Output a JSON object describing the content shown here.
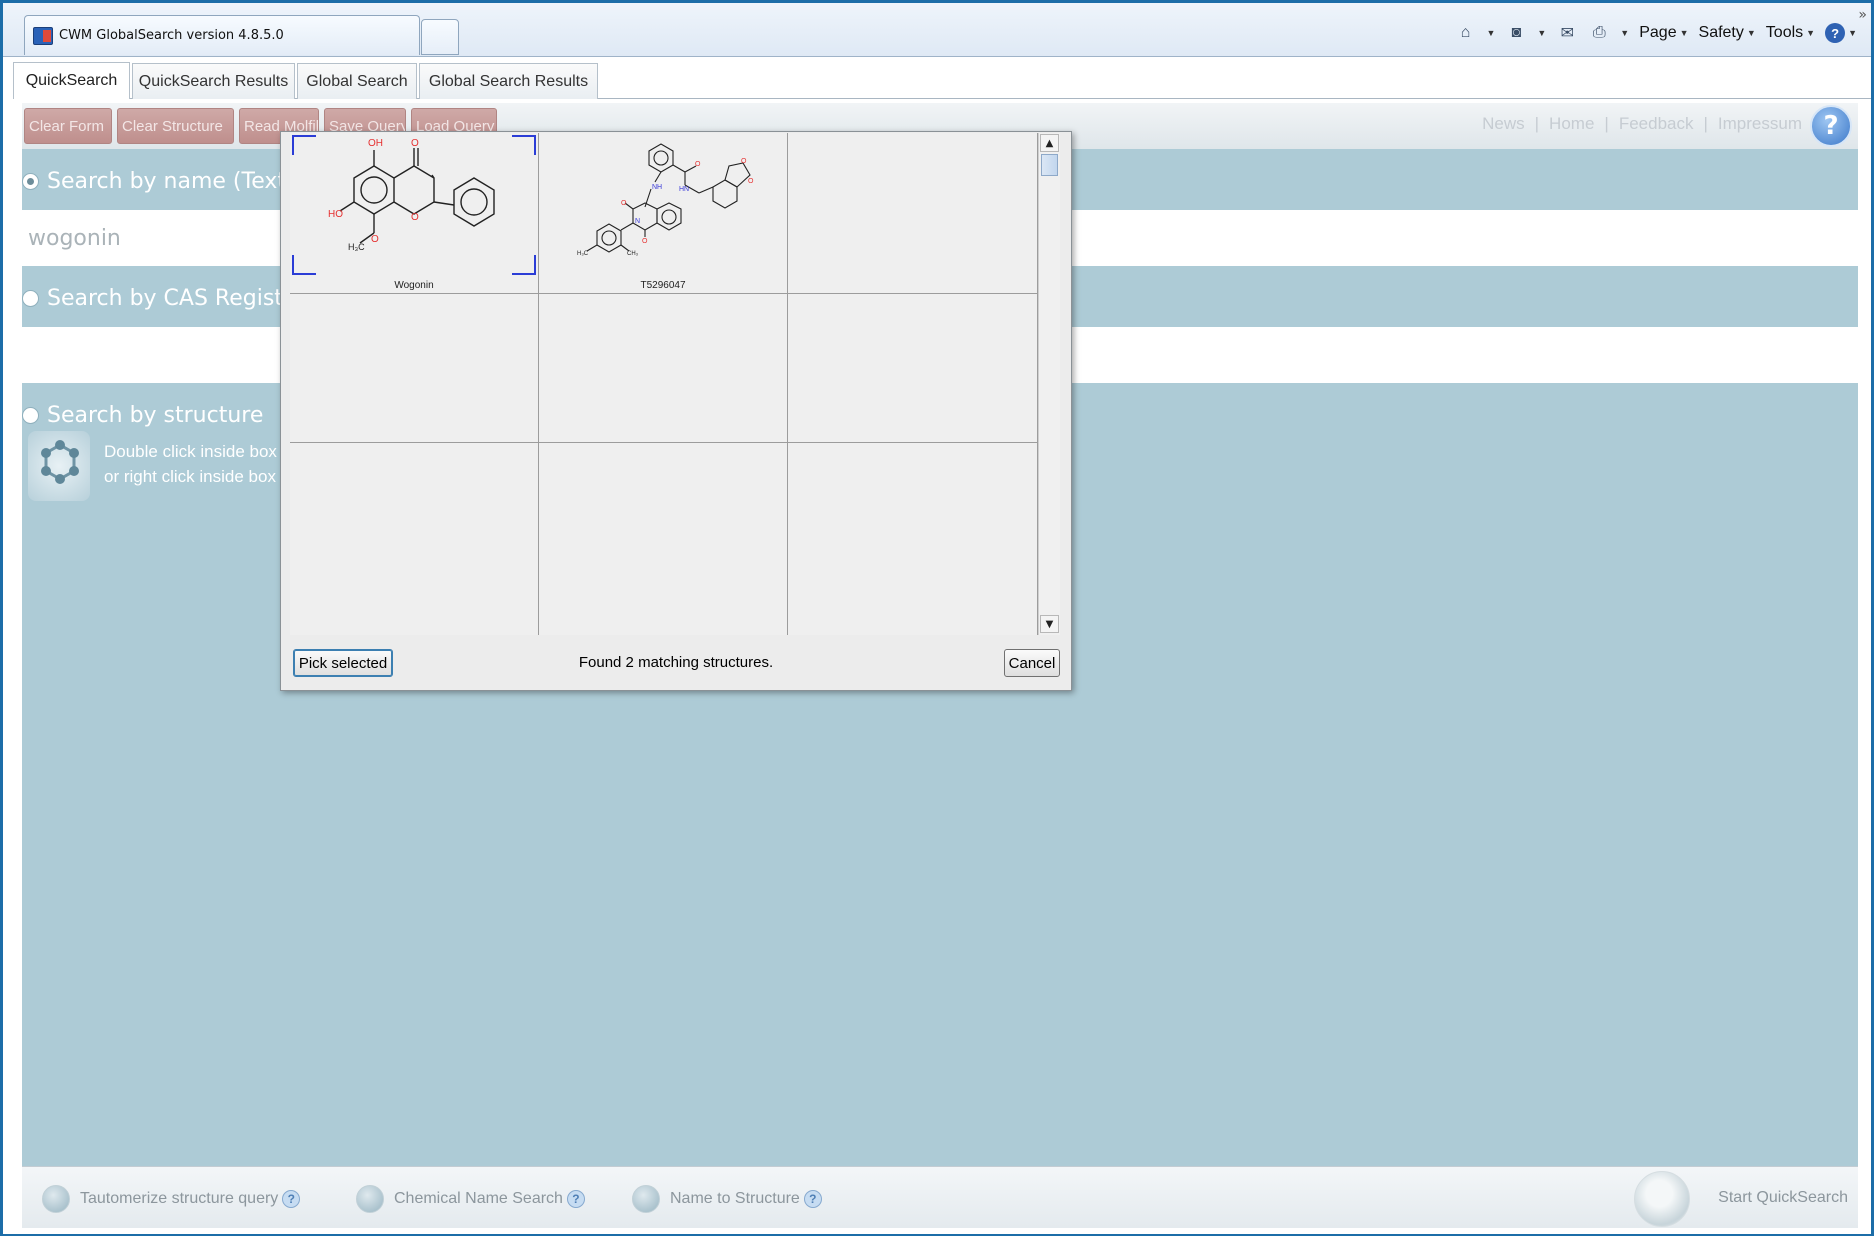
{
  "browser": {
    "tab_title": "CWM GlobalSearch version 4.8.5.0",
    "menus": [
      "Page",
      "Safety",
      "Tools"
    ],
    "overflow": "»"
  },
  "app_tabs": [
    "QuickSearch",
    "QuickSearch Results",
    "Global Search",
    "Global Search Results"
  ],
  "toolbar": {
    "buttons": [
      "Clear Form",
      "Clear Structure",
      "Read Molfile",
      "Save Query",
      "Load Query"
    ],
    "links": [
      "News",
      "Home",
      "Feedback",
      "Impressum"
    ],
    "sep": "|",
    "help": "?"
  },
  "search": {
    "by_name_label": "Search by name (Text)",
    "name_value": "wogonin",
    "by_cas_label": "Search by CAS Registry Number",
    "cas_value": "",
    "by_structure_label": "Search by structure",
    "structure_hint_1": "Double click inside box to draw structure",
    "structure_hint_2": "or right click inside box for more options"
  },
  "options": {
    "tautomerize": "Tautomerize structure query",
    "chemical_name": "Chemical Name Search",
    "name_to_structure": "Name to Structure",
    "help": "?",
    "start": "Start QuickSearch"
  },
  "dialog": {
    "results": [
      {
        "name": "Wogonin",
        "selected": true
      },
      {
        "name": "T5296047",
        "selected": false
      }
    ],
    "pick_label": "Pick selected",
    "status": "Found 2 matching structures.",
    "cancel_label": "Cancel"
  },
  "colors": {
    "content_bg": "#adcbd6",
    "toolbar_button": "#c39593",
    "selection": "#2b3dd6"
  }
}
